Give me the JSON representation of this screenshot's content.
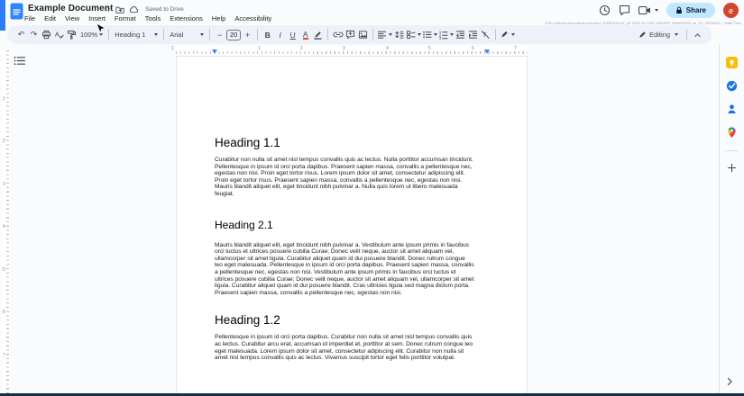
{
  "header": {
    "title": "Example Document",
    "saved_status": "Saved to Drive",
    "menus": [
      "File",
      "Edit",
      "View",
      "Insert",
      "Format",
      "Tools",
      "Extensions",
      "Help",
      "Accessibility"
    ],
    "canary": "POD editors.documents-frontend_20230414.02_p4 2023.11-TUE CANARY SHARD002 us_21 | NEWJCL - Main Tree",
    "share_label": "Share",
    "avatar_letter": "e"
  },
  "icons": {
    "undo": "↶",
    "redo": "↷",
    "star": "☆",
    "minus": "−",
    "plus": "+"
  },
  "toolbar": {
    "zoom": "100%",
    "style": "Heading 1",
    "font": "Arial",
    "font_size": "20",
    "bold": "B",
    "italic": "I",
    "underline": "U",
    "text_color": "A",
    "mode": "Editing"
  },
  "ruler": {
    "h": [
      "1",
      "1",
      "2",
      "3",
      "4",
      "5",
      "6",
      "7"
    ],
    "v": [
      "1",
      "2",
      "3",
      "4",
      "5",
      "6",
      "7"
    ]
  },
  "doc": {
    "sections": [
      {
        "heading": "Heading 1.1",
        "body": "Curabitur non nulla sit amet nisl tempus convallis quis ac lectus. Nulla porttitor accumsan tincidunt. Pellentesque in ipsum id orci porta dapibus. Praesent sapien massa, convallis a pellentesque nec, egestas non nisi. Proin eget tortor risus. Lorem ipsum dolor sit amet, consectetur adipiscing elit. Proin eget tortor risus. Praesent sapien massa, convallis a pellentesque nec, egestas non nisi. Mauris blandit aliquet elit, eget tincidunt nibh pulvinar a. Nulla quis lorem ut libero malesuada feugiat."
      },
      {
        "heading": "Heading 2.1",
        "body": "Mauris blandit aliquet elit, eget tincidunt nibh pulvinar a. Vestibulum ante ipsum primis in faucibus orci luctus et ultrices posuere cubilia Curae; Donec velit neque, auctor sit amet aliquam vel, ullamcorper sit amet ligula. Curabitur aliquet quam id dui posuere blandit. Donec rutrum congue leo eget malesuada. Pellentesque in ipsum id orci porta dapibus. Praesent sapien massa, convallis a pellentesque nec, egestas non nisi. Vestibulum ante ipsum primis in faucibus orci luctus et ultrices posuere cubilia Curae; Donec velit neque, auctor sit amet aliquam vel, ullamcorper sit amet ligula. Curabitur aliquet quam id dui posuere blandit. Cras ultricies ligula sed magna dictum porta. Praesent sapien massa, convallis a pellentesque nec, egestas non nisi."
      },
      {
        "heading": "Heading 1.2",
        "body": "Pellentesque in ipsum id orci porta dapibus. Curabitur non nulla sit amet nisl tempus convallis quis ac lectus. Curabitur arcu erat, accumsan id imperdiet et, porttitor at sem. Donec rutrum congue leo eget malesuada. Lorem ipsum dolor sit amet, consectetur adipiscing elit. Curabitur non nulla sit amet nisl tempus convallis quis ac lectus. Vivamus suscipit tortor eget felis porttitor volutpat."
      }
    ]
  },
  "side_panel": {
    "tools": [
      "Keep",
      "Tasks",
      "Contacts",
      "Maps"
    ]
  }
}
